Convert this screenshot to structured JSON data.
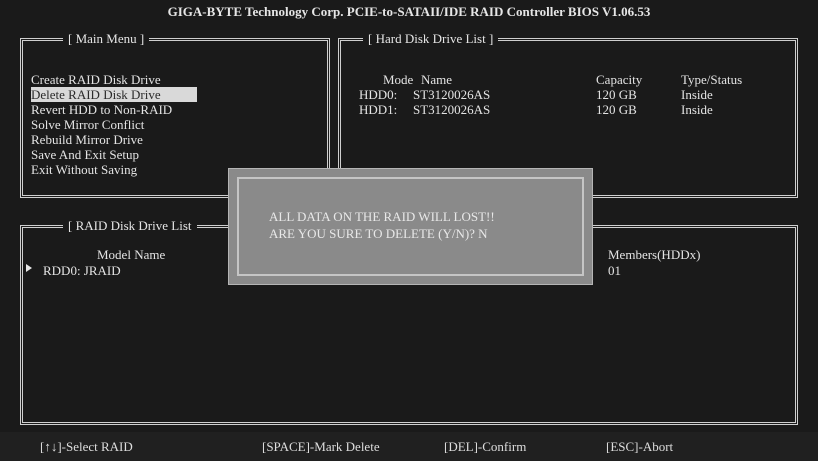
{
  "title": "GIGA-BYTE Technology Corp. PCIE-to-SATAII/IDE RAID Controller BIOS V1.06.53",
  "main_menu": {
    "title": "[ Main Menu ]",
    "items": [
      "Create RAID Disk Drive",
      "Delete RAID Disk Drive",
      "Revert HDD to Non-RAID",
      "Solve Mirror Conflict",
      "Rebuild Mirror Drive",
      "Save And Exit Setup",
      "Exit Without Saving"
    ],
    "selected_index": 1
  },
  "hdd_list": {
    "title": "[ Hard Disk Drive List ]",
    "headers": {
      "mode": "Mode",
      "name": "Name",
      "capacity": "Capacity",
      "type": "Type/Status"
    },
    "rows": [
      {
        "mode": "HDD0:",
        "name": "ST3120026AS",
        "capacity": "120 GB",
        "type": "Inside"
      },
      {
        "mode": "HDD1:",
        "name": "ST3120026AS",
        "capacity": "120 GB",
        "type": "Inside"
      }
    ]
  },
  "raid_list": {
    "title": "[ RAID Disk Drive List",
    "headers": {
      "model": "Model Name",
      "members": "Members(HDDx)"
    },
    "rows": [
      {
        "model": "RDD0: JRAID",
        "members": "01"
      }
    ]
  },
  "dialog": {
    "line1": "ALL DATA ON THE RAID WILL LOST!!",
    "line2": "ARE YOU SURE TO DELETE (Y/N)? N"
  },
  "footer": {
    "select": "[↑↓]-Select RAID",
    "mark": "[SPACE]-Mark Delete",
    "confirm": "[DEL]-Confirm",
    "abort": "[ESC]-Abort"
  },
  "colors": {
    "background": "#1a1a1a",
    "selection": "#d9d9d9",
    "dialog": "#8a8a8a"
  }
}
